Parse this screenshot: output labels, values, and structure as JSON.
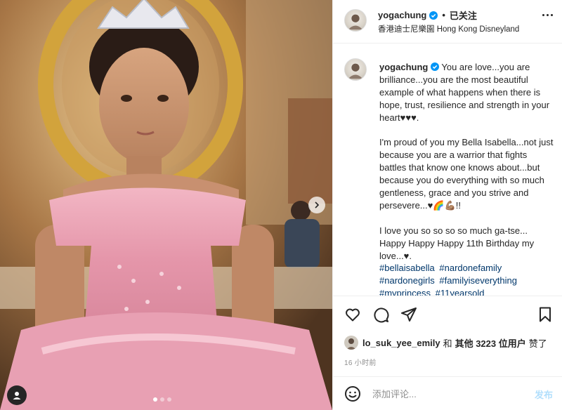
{
  "post": {
    "username": "yogachung",
    "follow_state": "已关注",
    "location": "香港迪士尼樂園 Hong Kong Disneyland",
    "caption_paragraphs": [
      "You are love...you are brilliance...you are the most beautiful example of what happens when there is hope, trust, resilience and strength in your heart♥♥♥.",
      "I'm proud of you my Bella Isabella...not just because you are a warrior that fights battles that know one knows about...but because you do everything with so much gentleness, grace and you strive and persevere...♥🌈💪🏽!!",
      "I love you so so so so much ga-tse... Happy Happy Happy 11th Birthday my love...♥."
    ],
    "hashtags": [
      "#bellaisabella",
      "#nardonefamily",
      "#nardonegirls",
      "#familyiseverything",
      "#myprincess",
      "#11yearsold"
    ],
    "liked_by_user": "lo_suk_yee_emily",
    "likes_joiner": "和",
    "likes_others": "其他 3223 位用户",
    "likes_suffix": "赞了",
    "time_ago": "16 小时前",
    "comment_placeholder": "添加评论...",
    "post_label": "发布"
  },
  "carousel": {
    "slide_count": 3,
    "active_index": 0
  },
  "icons": {
    "verified": "verified-badge-icon",
    "more": "more-options-icon",
    "like": "heart-icon",
    "comment": "comment-icon",
    "share": "share-icon",
    "save": "bookmark-icon",
    "emoji": "emoji-icon",
    "next": "chevron-right-icon",
    "tag": "user-tag-icon"
  },
  "colors": {
    "verified_blue": "#0095f6",
    "hashtag": "#00376b",
    "post_button_disabled": "#b2dffc",
    "muted_text": "#8e8e8e"
  }
}
